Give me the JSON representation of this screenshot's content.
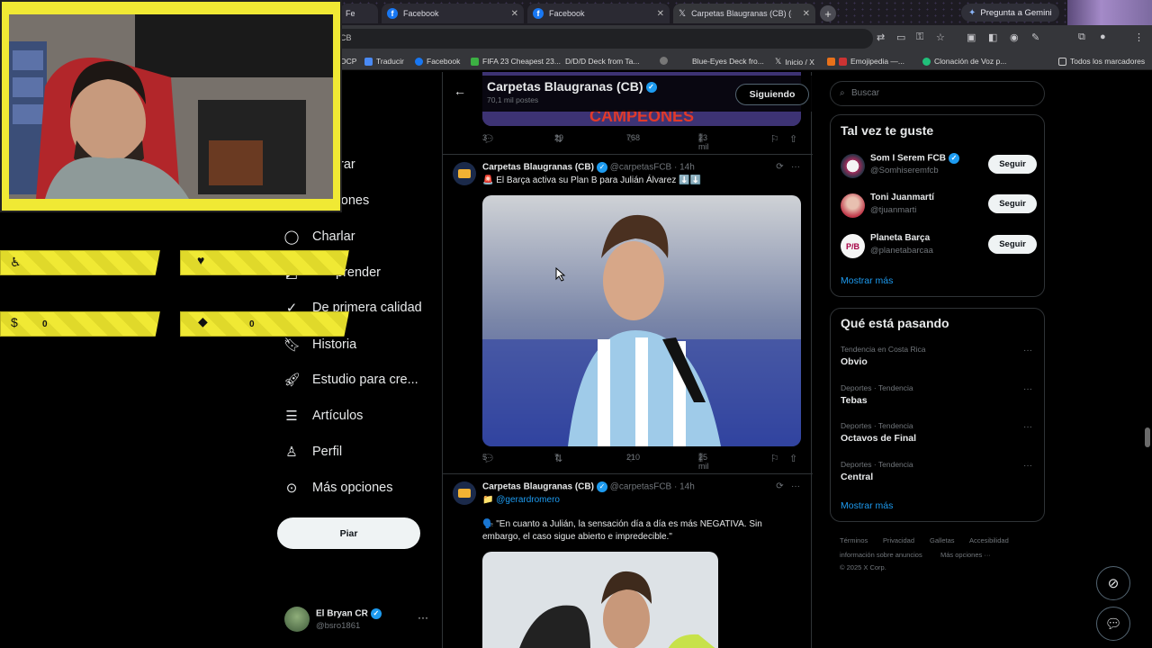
{
  "browser": {
    "tabs": [
      {
        "label": "Fe",
        "active": false
      },
      {
        "label": "Facebook",
        "active": false
      },
      {
        "label": "Facebook",
        "active": false
      },
      {
        "label": "Carpetas Blaugranas (CB) (@c",
        "active": true
      }
    ],
    "gemini_label": "Pregunta a Gemini",
    "url": "CB",
    "bookmarks": [
      "OCP",
      "Traducir",
      "Facebook",
      "FIFA 23 Cheapest 23...",
      "D/D/D Deck from Ta...",
      "Blue-Eyes Deck fro...",
      "Inicio / X",
      "Emojipedia —...",
      "Clonación de Voz p...",
      "Todos los marcadores"
    ]
  },
  "sidebar": {
    "items": [
      {
        "label": "rar",
        "icon": "explore-icon"
      },
      {
        "label": "caciones",
        "icon": "bell-icon"
      },
      {
        "label": "Charlar",
        "icon": "chat-icon"
      },
      {
        "label": "prender",
        "icon": "grok-icon"
      },
      {
        "label": "De primera calidad",
        "icon": "premium-icon"
      },
      {
        "label": "Historia",
        "icon": "bookmark-icon"
      },
      {
        "label": "Estudio para cre...",
        "icon": "rocket-icon"
      },
      {
        "label": "Artículos",
        "icon": "article-icon"
      },
      {
        "label": "Perfil",
        "icon": "user-icon"
      },
      {
        "label": "Más opciones",
        "icon": "more-circle-icon"
      }
    ],
    "post_button": "Piar",
    "account": {
      "name": "El Bryan CR",
      "handle": "@bsro1861",
      "more": "···"
    }
  },
  "overlay": {
    "stats": [
      {
        "icon": "donation-icon",
        "value": ""
      },
      {
        "icon": "heart-icon",
        "value": ""
      },
      {
        "icon": "dollar-icon",
        "value": "0"
      },
      {
        "icon": "diamond-icon",
        "value": "0"
      }
    ]
  },
  "timeline": {
    "title": "Carpetas Blaugranas (CB)",
    "subtitle": "70,1 mil postes",
    "follow_label": "Siguiendo",
    "tweet0_actions": {
      "replies": "3",
      "reposts": "29",
      "likes": "768",
      "views": "23 mil"
    },
    "tweets": [
      {
        "name": "Carpetas Blaugranas (CB)",
        "handle": "@carpetasFCB · 14h",
        "text": "🚨 El Barça activa su Plan B para Julián Álvarez ⬇️⬇️",
        "media_alt": "Julián Álvarez con camiseta de Argentina",
        "actions": {
          "replies": "5",
          "reposts": "7",
          "likes": "210",
          "views": "25 mil"
        }
      },
      {
        "name": "Carpetas Blaugranas (CB)",
        "handle": "@carpetasFCB · 14h",
        "mention": "📁 @gerardromero",
        "text": "🗣️ \"En cuanto a Julián, la sensación día a día es más NEGATIVA. Sin embargo, el caso sigue abierto e impredecible.\""
      }
    ]
  },
  "right": {
    "search_placeholder": "Buscar",
    "who_title": "Tal vez te guste",
    "who": [
      {
        "name": "Som I Serem FCB",
        "handle": "@Somhiseremfcb",
        "button": "Seguir"
      },
      {
        "name": "Toni Juanmartí",
        "handle": "@tjuanmarti",
        "button": "Seguir"
      },
      {
        "name": "Planeta Barça",
        "handle": "@planetabarcaa",
        "button": "Seguir"
      }
    ],
    "who_more": "Mostrar más",
    "trends_title": "Qué está pasando",
    "trends": [
      {
        "context": "Tendencia en Costa Rica",
        "name": "Obvio"
      },
      {
        "context": "Deportes · Tendencia",
        "name": "Tebas"
      },
      {
        "context": "Deportes · Tendencia",
        "name": "Octavos de Final"
      },
      {
        "context": "Deportes · Tendencia",
        "name": "Central"
      }
    ],
    "trends_more": "Mostrar más",
    "footer": [
      "Términos",
      "Privacidad",
      "Galletas",
      "Accesibilidad",
      "información sobre anuncios",
      "Más opciones ···",
      "© 2025 X Corp."
    ]
  },
  "colors": {
    "accent": "#1d9bf0",
    "overlay_yellow": "#f0e934",
    "background": "#000000"
  }
}
